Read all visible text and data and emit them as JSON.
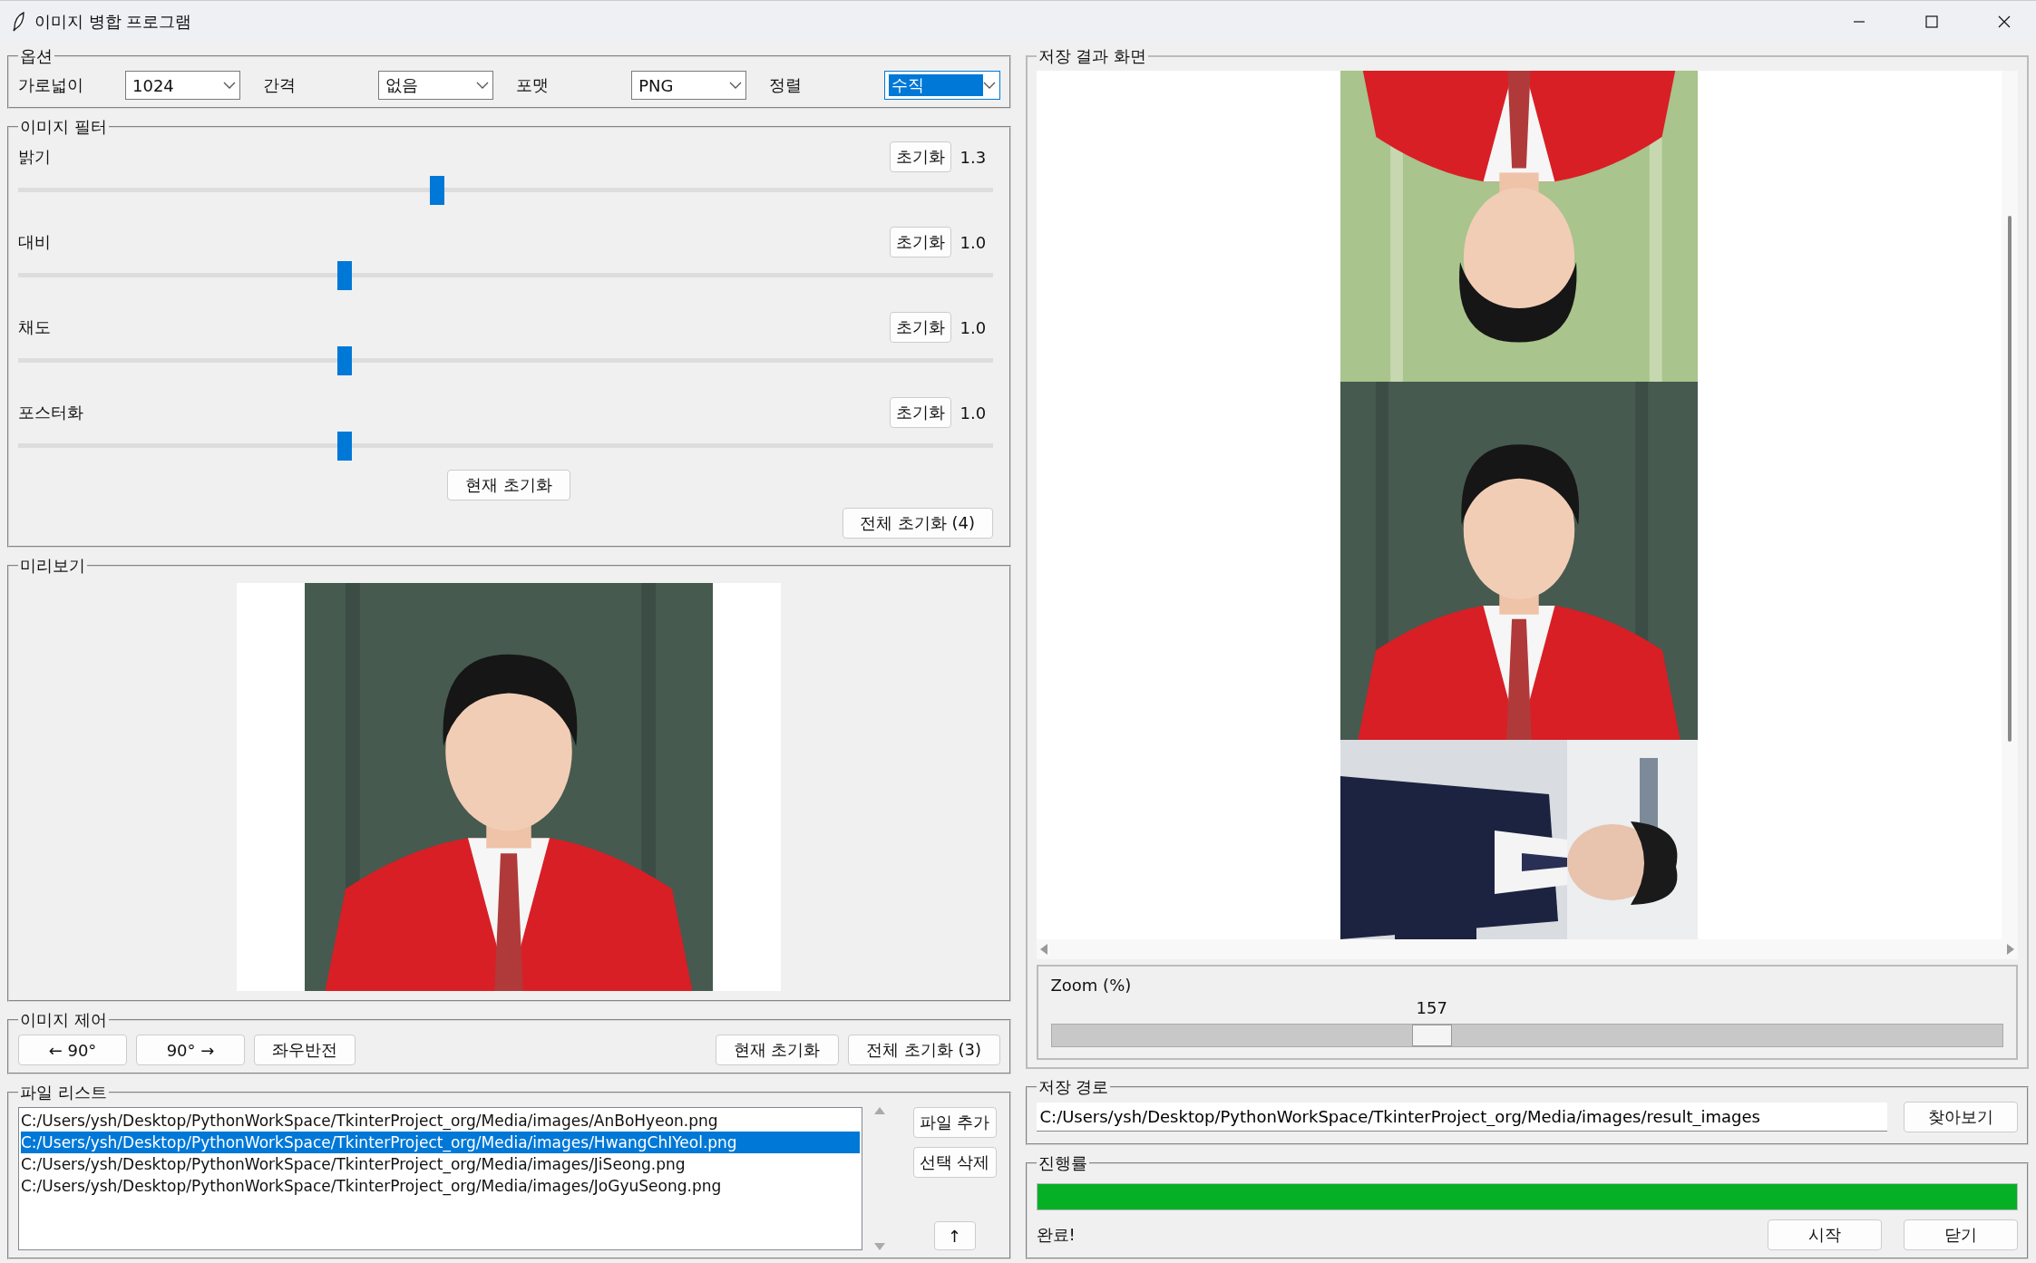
{
  "window": {
    "title": "이미지 병합 프로그램"
  },
  "options": {
    "title": "옵션",
    "fields": [
      {
        "label": "가로넓이",
        "value": "1024",
        "focused": false
      },
      {
        "label": "간격",
        "value": "없음",
        "focused": false
      },
      {
        "label": "포맷",
        "value": "PNG",
        "focused": false
      },
      {
        "label": "정렬",
        "value": "수직",
        "focused": true
      }
    ]
  },
  "filters": {
    "title": "이미지 필터",
    "items": [
      {
        "label": "밝기",
        "reset": "초기화",
        "value": "1.3",
        "level": 0.43
      },
      {
        "label": "대비",
        "reset": "초기화",
        "value": "1.0",
        "level": 0.335
      },
      {
        "label": "채도",
        "reset": "초기화",
        "value": "1.0",
        "level": 0.335
      },
      {
        "label": "포스터화",
        "reset": "초기화",
        "value": "1.0",
        "level": 0.335
      }
    ],
    "reset_current": "현재 초기화",
    "reset_all": "전체 초기화 (4)"
  },
  "preview": {
    "title": "미리보기"
  },
  "image_control": {
    "title": "이미지 제어",
    "buttons": [
      {
        "label": "← 90°",
        "kind": "left"
      },
      {
        "label": "90° →",
        "kind": "left"
      },
      {
        "label": "좌우반전",
        "kind": "left"
      },
      {
        "label": "현재 초기화",
        "kind": "right"
      },
      {
        "label": "전체 초기화 (3)",
        "kind": "right"
      }
    ]
  },
  "file_list": {
    "title": "파일 리스트",
    "files": [
      {
        "path": "C:/Users/ysh/Desktop/PythonWorkSpace/TkinterProject_org/Media/images/AnBoHyeon.png",
        "selected": false
      },
      {
        "path": "C:/Users/ysh/Desktop/PythonWorkSpace/TkinterProject_org/Media/images/HwangChIYeol.png",
        "selected": true
      },
      {
        "path": "C:/Users/ysh/Desktop/PythonWorkSpace/TkinterProject_org/Media/images/JiSeong.png",
        "selected": false
      },
      {
        "path": "C:/Users/ysh/Desktop/PythonWorkSpace/TkinterProject_org/Media/images/JoGyuSeong.png",
        "selected": false
      }
    ],
    "buttons": [
      "파일 추가",
      "선택 삭제"
    ],
    "up_button": "↑"
  },
  "result": {
    "title": "저장 결과 화면",
    "zoom": {
      "label": "Zoom (%)",
      "value": "157",
      "level": 0.4
    }
  },
  "save_path": {
    "title": "저장 경로",
    "value": "C:/Users/ysh/Desktop/PythonWorkSpace/TkinterProject_org/Media/images/result_images",
    "button": "찾아보기"
  },
  "progress": {
    "title": "진행률",
    "level": 1.0,
    "status": "완료!",
    "buttons": [
      "시작",
      "닫기"
    ]
  }
}
